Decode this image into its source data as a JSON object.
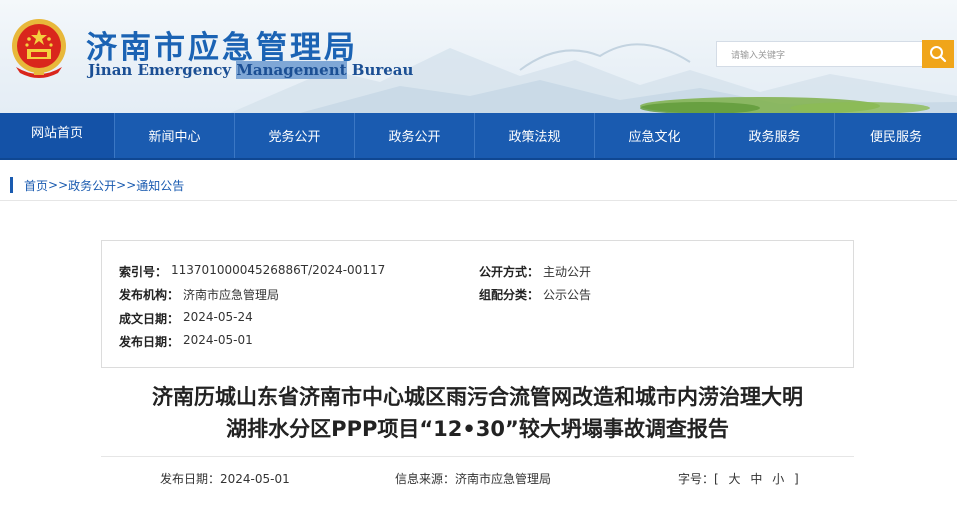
{
  "header": {
    "title": "济南市应急管理局",
    "subtitle_parts": [
      "Jinan Emergency ",
      "Management",
      " Bureau"
    ],
    "search_placeholder": "请输入关键字",
    "emblem_icon": "national-emblem-icon",
    "search_icon": "search-icon",
    "accent": "#1a5bb0",
    "search_button_color": "#f0a51a"
  },
  "nav": {
    "items": [
      "网站首页",
      "新闻中心",
      "党务公开",
      "政务公开",
      "政策法规",
      "应急文化",
      "政务服务",
      "便民服务"
    ]
  },
  "breadcrumb": {
    "items": [
      "首页",
      "政务公开",
      "通知公告"
    ],
    "separator": ">>"
  },
  "info": {
    "index_label": "索引号：",
    "index_value": "11370100004526886T/2024-00117",
    "publisher_label": "发布机构：",
    "publisher_value": "济南市应急管理局",
    "created_label": "成文日期：",
    "created_value": "2024-05-24",
    "published_label": "发布日期：",
    "published_value": "2024-05-01",
    "mode_label": "公开方式：",
    "mode_value": "主动公开",
    "category_label": "组配分类：",
    "category_value": "公示公告"
  },
  "article": {
    "title_line1": "济南历城山东省济南市中心城区雨污合流管网改造和城市内涝治理大明",
    "title_line2": "湖排水分区PPP项目“12•30”较大坍塌事故调查报告",
    "date_label": "发布日期：",
    "date_value": "2024-05-01",
    "source_label": "信息来源：",
    "source_value": "济南市应急管理局",
    "fontsize_label": "字号：",
    "fontsize_options": [
      "大",
      "中",
      "小"
    ]
  }
}
